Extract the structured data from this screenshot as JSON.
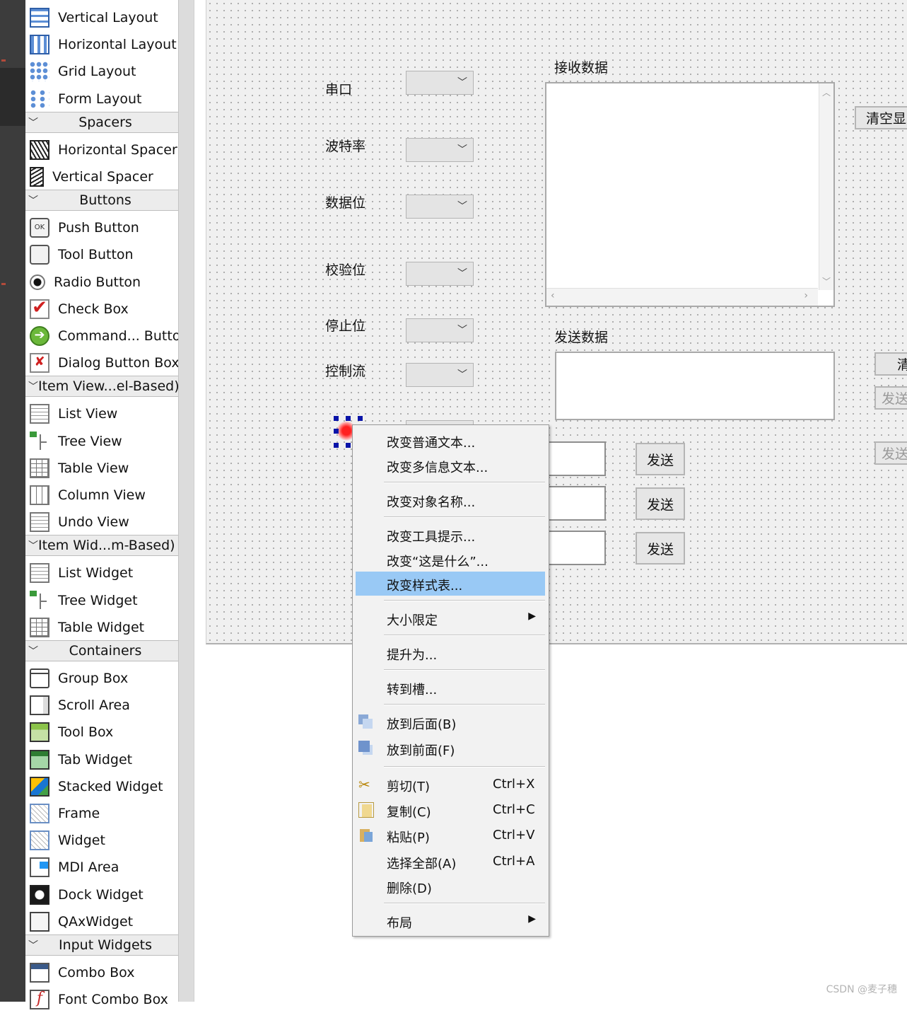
{
  "widget_box": {
    "items": [
      {
        "type": "item",
        "label": "Vertical Layout",
        "icon": "vertical-layout-icon",
        "cls": "i-layout-v"
      },
      {
        "type": "item",
        "label": "Horizontal Layout",
        "icon": "horizontal-layout-icon",
        "cls": "i-layout-h"
      },
      {
        "type": "item",
        "label": "Grid Layout",
        "icon": "grid-layout-icon",
        "cls": "i-grid"
      },
      {
        "type": "item",
        "label": "Form Layout",
        "icon": "form-layout-icon",
        "cls": "i-form"
      },
      {
        "type": "cat",
        "label": "Spacers"
      },
      {
        "type": "item",
        "label": "Horizontal Spacer",
        "icon": "horizontal-spacer-icon",
        "cls": "i-hspacer"
      },
      {
        "type": "item",
        "label": "Vertical Spacer",
        "icon": "vertical-spacer-icon",
        "cls": "i-vspacer"
      },
      {
        "type": "cat",
        "label": "Buttons"
      },
      {
        "type": "item",
        "label": "Push Button",
        "icon": "push-button-icon",
        "cls": "i-push",
        "glyph": "OK"
      },
      {
        "type": "item",
        "label": "Tool Button",
        "icon": "tool-button-icon",
        "cls": "i-tool"
      },
      {
        "type": "item",
        "label": "Radio Button",
        "icon": "radio-button-icon",
        "cls": "i-radio"
      },
      {
        "type": "item",
        "label": "Check Box",
        "icon": "check-box-icon",
        "cls": "i-check",
        "glyph": "✔"
      },
      {
        "type": "item",
        "label": "Command... Button",
        "icon": "command-link-button-icon",
        "cls": "i-cmd",
        "glyph": "➔"
      },
      {
        "type": "item",
        "label": "Dialog Button Box",
        "icon": "dialog-button-box-icon",
        "cls": "i-dlg",
        "glyph": "✘"
      },
      {
        "type": "cat",
        "label": "Item View...el-Based)"
      },
      {
        "type": "item",
        "label": "List View",
        "icon": "list-view-icon",
        "cls": "i-list"
      },
      {
        "type": "item",
        "label": "Tree View",
        "icon": "tree-view-icon",
        "cls": "i-tree"
      },
      {
        "type": "item",
        "label": "Table View",
        "icon": "table-view-icon",
        "cls": "i-table"
      },
      {
        "type": "item",
        "label": "Column View",
        "icon": "column-view-icon",
        "cls": "i-column"
      },
      {
        "type": "item",
        "label": "Undo View",
        "icon": "undo-view-icon",
        "cls": "i-list"
      },
      {
        "type": "cat",
        "label": "Item Wid...m-Based)"
      },
      {
        "type": "item",
        "label": "List Widget",
        "icon": "list-widget-icon",
        "cls": "i-list"
      },
      {
        "type": "item",
        "label": "Tree Widget",
        "icon": "tree-widget-icon",
        "cls": "i-tree"
      },
      {
        "type": "item",
        "label": "Table Widget",
        "icon": "table-widget-icon",
        "cls": "i-table"
      },
      {
        "type": "cat",
        "label": "Containers"
      },
      {
        "type": "item",
        "label": "Group Box",
        "icon": "group-box-icon",
        "cls": "i-group"
      },
      {
        "type": "item",
        "label": "Scroll Area",
        "icon": "scroll-area-icon",
        "cls": "i-scroll"
      },
      {
        "type": "item",
        "label": "Tool Box",
        "icon": "tool-box-icon",
        "cls": "i-toolbox"
      },
      {
        "type": "item",
        "label": "Tab Widget",
        "icon": "tab-widget-icon",
        "cls": "i-tab"
      },
      {
        "type": "item",
        "label": "Stacked Widget",
        "icon": "stacked-widget-icon",
        "cls": "i-stacked"
      },
      {
        "type": "item",
        "label": "Frame",
        "icon": "frame-icon",
        "cls": "i-frame"
      },
      {
        "type": "item",
        "label": "Widget",
        "icon": "widget-icon",
        "cls": "i-frame"
      },
      {
        "type": "item",
        "label": "MDI Area",
        "icon": "mdi-area-icon",
        "cls": "i-mdi"
      },
      {
        "type": "item",
        "label": "Dock Widget",
        "icon": "dock-widget-icon",
        "cls": "i-dock"
      },
      {
        "type": "item",
        "label": "QAxWidget",
        "icon": "qaxwidget-icon",
        "cls": "i-qax"
      },
      {
        "type": "cat",
        "label": "Input Widgets"
      },
      {
        "type": "item",
        "label": "Combo Box",
        "icon": "combo-box-icon",
        "cls": "i-combo"
      },
      {
        "type": "item",
        "label": "Font Combo Box",
        "icon": "font-combo-box-icon",
        "cls": "i-font",
        "glyph": "f"
      }
    ]
  },
  "form": {
    "labels": {
      "port": "串口",
      "baud": "波特率",
      "data_bits": "数据位",
      "parity": "校验位",
      "stop_bits": "停止位",
      "flow_control": "控制流",
      "receive": "接收数据",
      "send": "发送数据"
    },
    "buttons": {
      "clear_display": "清空显示",
      "clear_send": "清",
      "send_main": "发送",
      "send_timer": "发送",
      "send_1": "发送",
      "send_2": "发送",
      "send_3": "发送"
    }
  },
  "context_menu": {
    "change_plain_text": "改变普通文本...",
    "change_rich_text": "改变多信息文本...",
    "change_object_name": "改变对象名称...",
    "change_tooltip": "改变工具提示...",
    "change_whats_this": "改变“这是什么”...",
    "change_stylesheet": "改变样式表...",
    "size_constraints": "大小限定",
    "promote_to": "提升为...",
    "go_to_slot": "转到槽...",
    "send_to_back": "放到后面(B)",
    "bring_to_front": "放到前面(F)",
    "cut": "剪切(T)",
    "cut_shortcut": "Ctrl+X",
    "copy": "复制(C)",
    "copy_shortcut": "Ctrl+C",
    "paste": "粘贴(P)",
    "paste_shortcut": "Ctrl+V",
    "select_all": "选择全部(A)",
    "select_all_shortcut": "Ctrl+A",
    "delete": "删除(D)",
    "layout": "布局",
    "submenu_arrow": "▶"
  },
  "watermark": "CSDN @麦子穗",
  "colors": {
    "menu_highlight": "#99c9f5",
    "selection_handle": "#0a14a8",
    "selected_widget": "#ff3030"
  }
}
